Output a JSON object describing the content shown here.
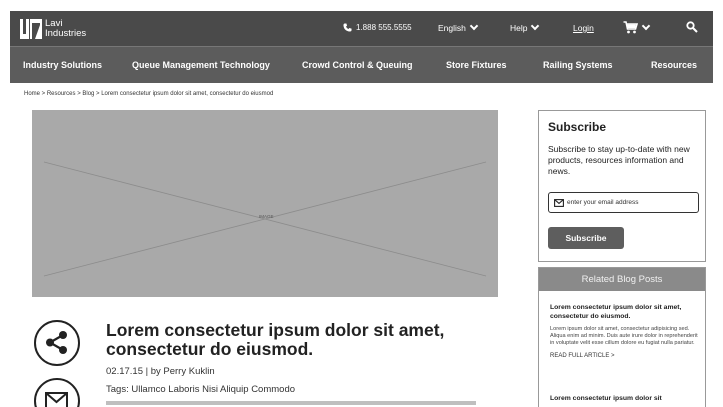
{
  "header": {
    "logo_line1": "Lavi",
    "logo_line2": "Industries",
    "phone": "1.888 555.5555",
    "language": "English",
    "help": "Help",
    "login": "Login"
  },
  "nav": {
    "items": [
      "Industry Solutions",
      "Queue Management Technology",
      "Crowd Control & Queuing",
      "Store Fixtures",
      "Railing Systems",
      "Resources"
    ]
  },
  "breadcrumb": "Home  >  Resources >  Blog  >  Lorem consectetur ipsum dolor sit amet, consectetur do eiusmod",
  "hero": {
    "label": "IMAGE"
  },
  "post": {
    "title": "Lorem consectetur ipsum dolor sit amet, consectetur do eiusmod.",
    "meta": "02.17.15   |   by Perry Kuklin",
    "tags": "Tags: Ullamco Laboris Nisi Aliquip Commodo"
  },
  "subscribe": {
    "title": "Subscribe",
    "text": "Subscribe to stay up-to-date with new products, resources information and news.",
    "placeholder": "enter your email address",
    "button": "Subscribe"
  },
  "related": {
    "heading": "Related Blog Posts",
    "items": [
      {
        "title": "Lorem consectetur ipsum dolor sit amet, consectetur do eiusmod.",
        "excerpt": "Lorem ipsum dolor sit amet, consectetur adipisicing sed. Aliqua enim ad minim. Duis aute irure dolor in reprehenderit in voluptate velit esse cillum dolore eu fugiat nulla pariatur.",
        "read_more": "READ FULL ARTICLE >"
      },
      {
        "title": "Lorem consectetur ipsum dolor sit",
        "excerpt": "",
        "read_more": ""
      }
    ]
  },
  "colors": {
    "header_bg": "#4a4a4a",
    "nav_bg": "#5c5c5c",
    "image_placeholder": "#a9a9a9",
    "button_bg": "#5e5e5e",
    "related_header_bg": "#8a8a8a"
  },
  "icons": [
    "phone-icon",
    "chevron-down-icon",
    "cart-icon",
    "search-icon",
    "share-icon",
    "mail-icon"
  ]
}
